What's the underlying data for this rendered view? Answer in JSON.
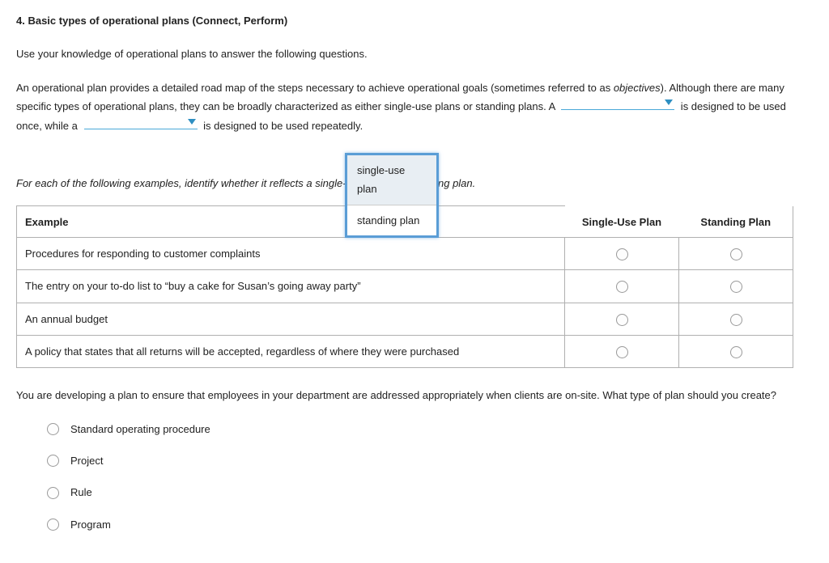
{
  "title": "4. Basic types of operational plans (Connect, Perform)",
  "intro": "Use your knowledge of operational plans to answer the following questions.",
  "para": {
    "seg1": "An operational plan provides a detailed road map of the steps necessary to achieve operational goals (sometimes referred to as ",
    "obj": "objectives",
    "seg2": "). Although there are many specific types of operational plans, they can be broadly characterized as either single-use plans or standing plans. A ",
    "seg3": " is designed to be used once, while a ",
    "seg4": " is designed to be used repeatedly."
  },
  "dropdown": {
    "opt1": "single-use plan",
    "opt2": "standing plan"
  },
  "instruction": "For each of the following examples, identify whether it reflects a single-use plan or a standing plan.",
  "table": {
    "headers": {
      "example": "Example",
      "single": "Single-Use Plan",
      "standing": "Standing Plan"
    },
    "rows": [
      {
        "text": "Procedures for responding to customer complaints"
      },
      {
        "text": "The entry on your to-do list to “buy a cake for Susan’s going away party”"
      },
      {
        "text": "An annual budget"
      },
      {
        "text": "A policy that states that all returns will be accepted, regardless of where they were purchased"
      }
    ]
  },
  "question2": "You are developing a plan to ensure that employees in your department are addressed appropriately when clients are on-site. What type of plan should you create?",
  "choices": [
    "Standard operating procedure",
    "Project",
    "Rule",
    "Program"
  ]
}
